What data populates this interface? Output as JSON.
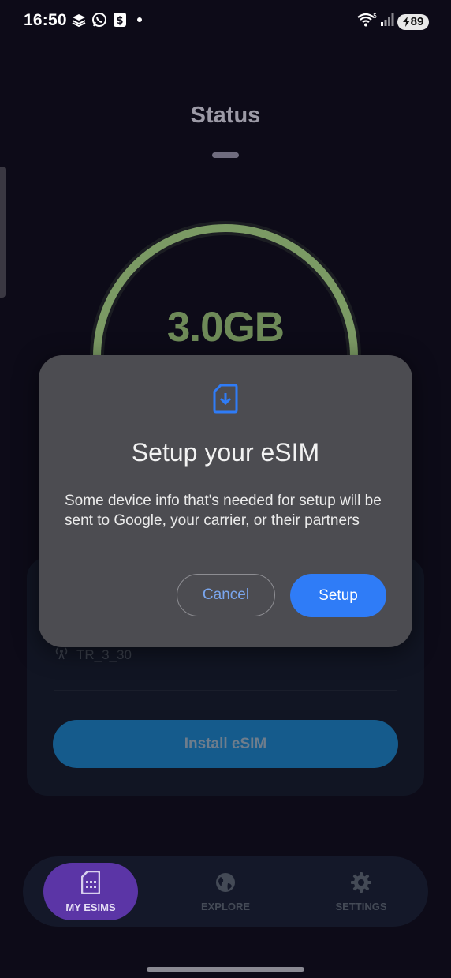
{
  "statusbar": {
    "time": "16:50",
    "battery": "89",
    "wifi_badge": "5"
  },
  "screen": {
    "title": "Status"
  },
  "usage": {
    "amount": "3.0GB",
    "ring_color": "#86a86b"
  },
  "plan_card": {
    "network": "TR_3_30",
    "install_label": "Install eSIM"
  },
  "dialog": {
    "icon": "sim-download-icon",
    "title": "Setup your eSIM",
    "body": "Some device info that's needed for setup will be sent to Google, your carrier, or their partners",
    "cancel_label": "Cancel",
    "setup_label": "Setup",
    "accent": "#2f7cf7"
  },
  "bottom_nav": {
    "items": [
      {
        "label": "MY ESIMS",
        "icon": "sim-card-icon",
        "active": true
      },
      {
        "label": "EXPLORE",
        "icon": "globe-icon",
        "active": false
      },
      {
        "label": "SETTINGS",
        "icon": "gear-icon",
        "active": false
      }
    ],
    "active_color": "#5b35a6"
  }
}
